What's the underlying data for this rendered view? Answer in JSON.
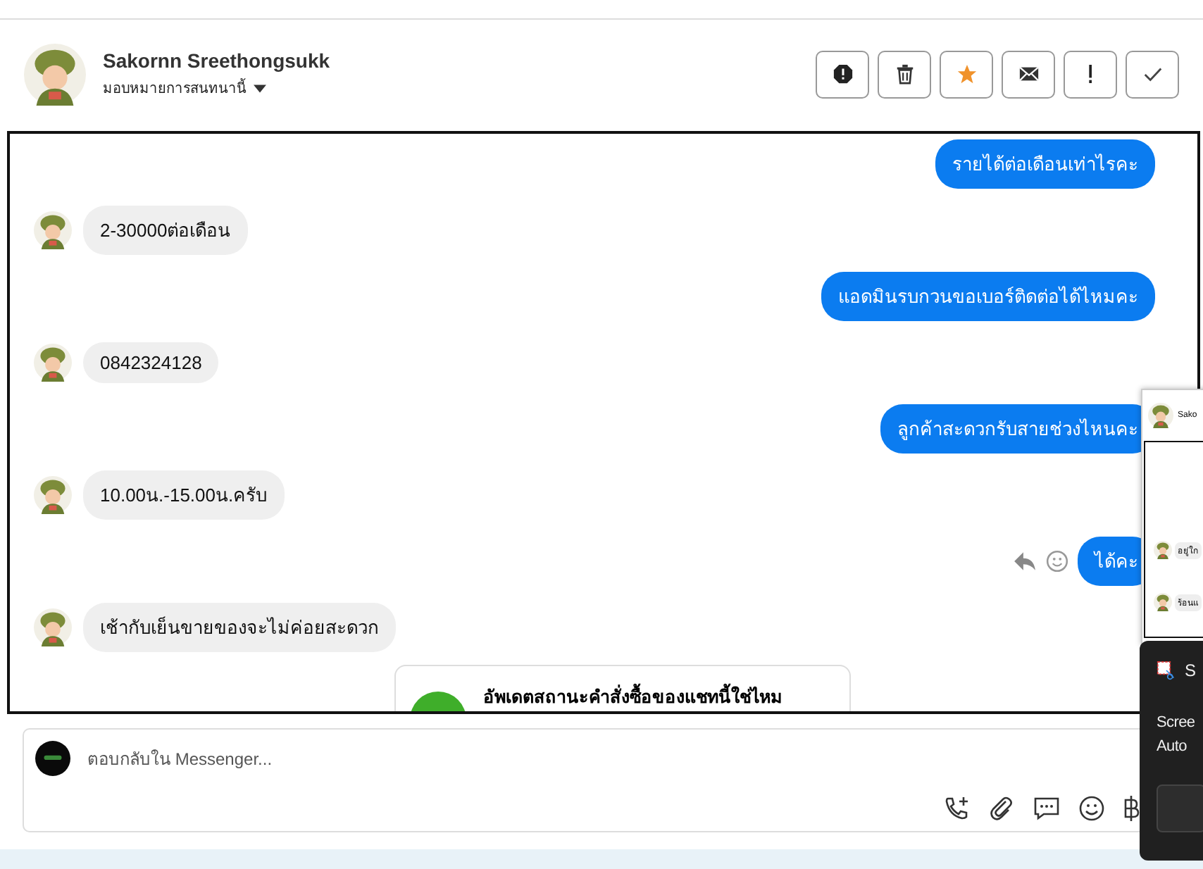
{
  "contact": {
    "name": "Sakornn Sreethongsukk",
    "subtitle": "มอบหมายการสนทนานี้"
  },
  "header_buttons": [
    {
      "kind": "block"
    },
    {
      "kind": "delete"
    },
    {
      "kind": "star"
    },
    {
      "kind": "mail"
    },
    {
      "kind": "alert"
    },
    {
      "kind": "check"
    }
  ],
  "messages": [
    {
      "kind": "sent",
      "text": "รายได้ต่อเดือนเท่าไรคะ",
      "show_actions": false
    },
    {
      "kind": "received",
      "text": "2-30000ต่อเดือน",
      "show_actions": false
    },
    {
      "kind": "sent",
      "text": "แอดมินรบกวนขอเบอร์ติดต่อได้ไหมคะ",
      "show_actions": false
    },
    {
      "kind": "received",
      "text": "0842324128",
      "show_actions": false
    },
    {
      "kind": "sent",
      "text": "ลูกค้าสะดวกรับสายช่วงไหนคะ",
      "show_actions": false
    },
    {
      "kind": "received",
      "text": "10.00น.-15.00น.ครับ",
      "show_actions": false
    },
    {
      "kind": "sent",
      "text": "ได้คะ",
      "show_actions": true
    },
    {
      "kind": "received",
      "text": "เช้ากับเย็นขายของจะไม่ค่อยสะดวก",
      "show_actions": false
    }
  ],
  "order_card": {
    "text": "อัพเดตสถานะคำสั่งซื้อของแชทนี้ใช่ไหม"
  },
  "composer": {
    "placeholder": "ตอบกลับใน Messenger..."
  },
  "preview_window": {
    "title": "Sako",
    "lines": [
      "อยู่ใก",
      "ร้อนแ"
    ]
  },
  "toast": {
    "app": "S",
    "lines": [
      "Scree",
      "Auto"
    ]
  }
}
